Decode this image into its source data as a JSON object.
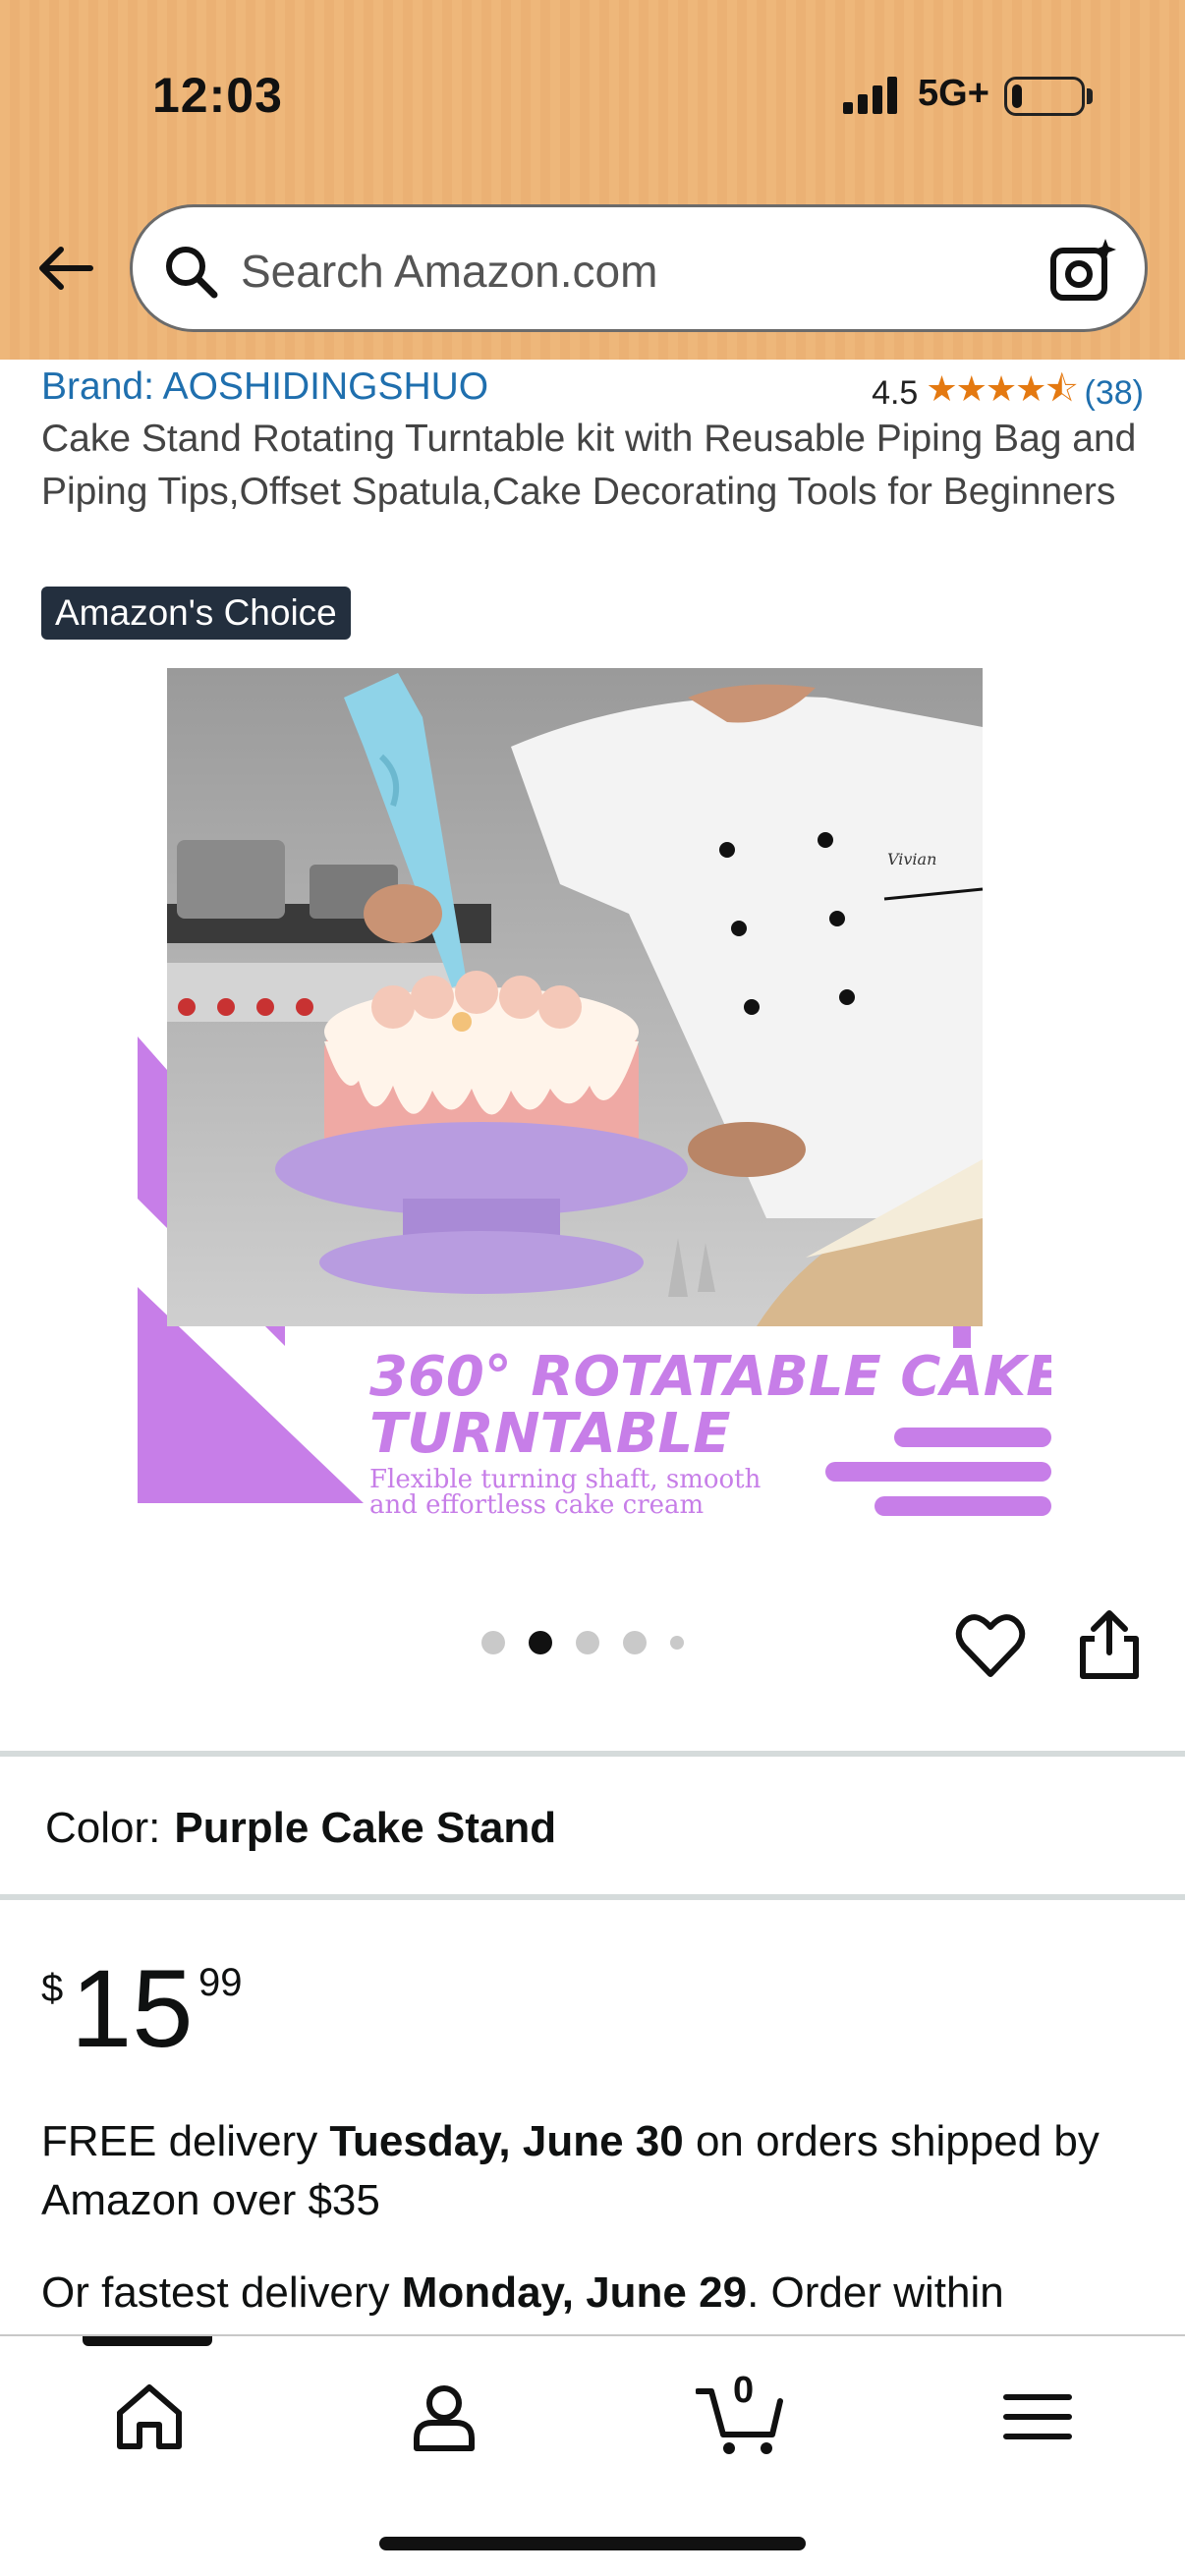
{
  "status_bar": {
    "time": "12:03",
    "network": "5G+"
  },
  "header": {
    "search_placeholder": "Search Amazon.com"
  },
  "product": {
    "brand": "Brand: AOSHIDINGSHUO",
    "rating": "4.5",
    "stars": "★★★★⯪",
    "review_count": "(38)",
    "title": "Cake Stand Rotating Turntable kit with Reusable Piping Bag and Piping Tips,Offset Spatula,Cake Decorating Tools for Beginners",
    "badge": "Amazon's Choice",
    "image": {
      "headline_line1": "360° ROTATABLE CAKE",
      "headline_line2": "TURNTABLE",
      "subtext_line1": "Flexible turning shaft, smooth",
      "subtext_line2": "and effortless cake cream",
      "apron_text": "Vivian"
    },
    "image_count": 5,
    "active_image_index": 1
  },
  "color": {
    "label": "Color:",
    "value": "Purple Cake Stand"
  },
  "price": {
    "symbol": "$",
    "whole": "15",
    "fraction": "99"
  },
  "delivery": {
    "prefix": "FREE delivery ",
    "date": "Tuesday, June 30",
    "suffix": " on orders shipped by Amazon over $35"
  },
  "fastest": {
    "prefix": "Or fastest delivery ",
    "date": "Monday, June 29",
    "suffix": ". Order within"
  },
  "bottom_nav": {
    "cart_count": "0"
  },
  "colors": {
    "header_bg": "#eeb77a",
    "link": "#1f6fae",
    "star": "#e47911",
    "badge_bg": "#232f3e",
    "accent_purple": "#c77ee8"
  },
  "icons": [
    "back-arrow-icon",
    "search-icon",
    "camera-icon",
    "heart-icon",
    "share-icon",
    "home-icon",
    "account-icon",
    "cart-icon",
    "menu-icon"
  ]
}
